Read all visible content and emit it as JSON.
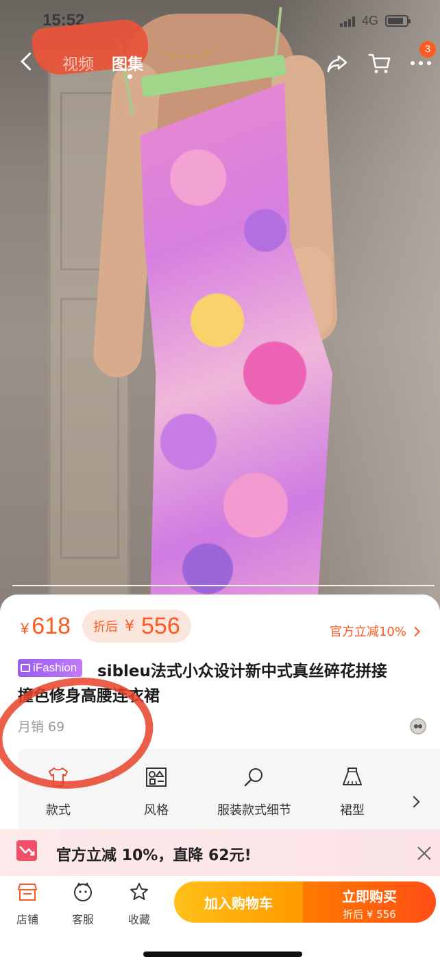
{
  "status_bar": {
    "time": "15:52",
    "network": "4G"
  },
  "nav": {
    "tabs": [
      {
        "label": "视频",
        "active": false
      },
      {
        "label": "图集",
        "active": true
      }
    ],
    "cart_badge": "3",
    "icons": [
      "back-icon",
      "share-icon",
      "cart-icon",
      "more-icon"
    ]
  },
  "price": {
    "currency": "¥",
    "original": "618",
    "after_label": "折后",
    "after": "556",
    "discount_link": "官方立减10%"
  },
  "product": {
    "tag": "iFashion",
    "title_line1": "sibleu法式小众设计新中式真丝碎花拼接",
    "title_line2": "撞色修身高腰连衣裙",
    "sales": "月销 69"
  },
  "attributes": [
    {
      "label": "款式",
      "icon": "tshirt-icon"
    },
    {
      "label": "风格",
      "icon": "style-icon"
    },
    {
      "label": "服装款式细节",
      "icon": "magnifier-icon"
    },
    {
      "label": "裙型",
      "icon": "skirt-icon"
    }
  ],
  "promo": {
    "text": "官方立减 10%，直降 62元!"
  },
  "bottom_bar": {
    "shop": "店铺",
    "service": "客服",
    "favorite": "收藏",
    "add_to_cart": "加入购物车",
    "buy_now": "立即购买",
    "buy_now_sub": "折后 ¥ 556"
  },
  "colors": {
    "accent": "#ff5a1f",
    "cart_button": "#ffb000",
    "buy_button": "#ff5a1f",
    "tag_purple": "#a869f2",
    "annotation_red": "#e8432a"
  }
}
